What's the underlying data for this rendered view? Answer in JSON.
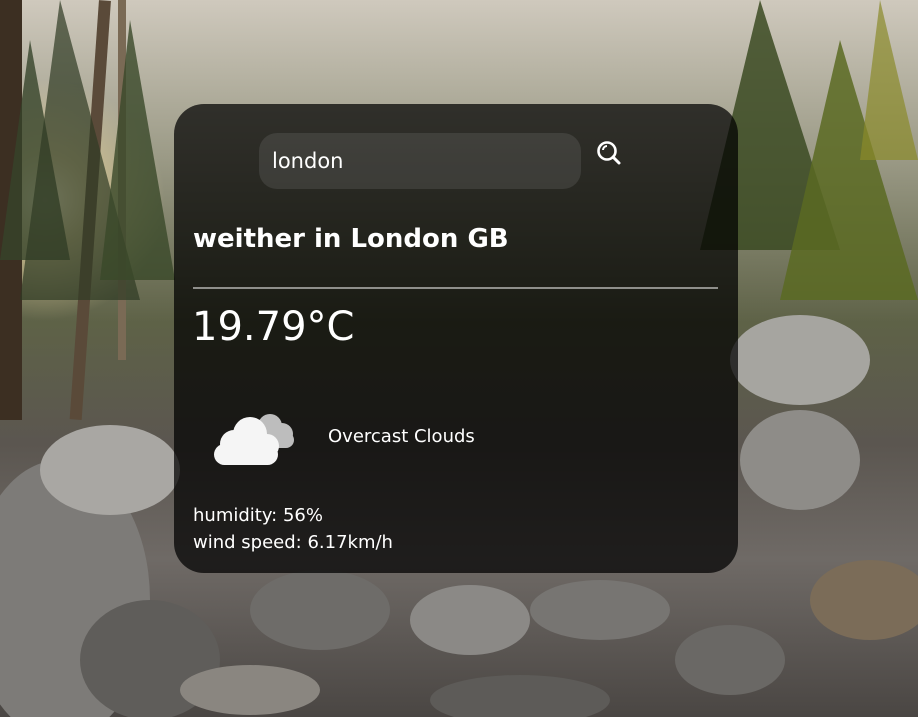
{
  "search": {
    "value": "london",
    "placeholder": ""
  },
  "weather": {
    "title": "weither in London GB",
    "temperature": "19.79°C",
    "condition": "Overcast Clouds",
    "humidity": "humidity: 56%",
    "wind": "wind speed: 6.17km/h"
  },
  "icons": {
    "search": "search-icon",
    "condition": "overcast-clouds-icon"
  },
  "colors": {
    "card_bg": "#000000b8",
    "text": "#ffffff",
    "search_bg": "#82828238"
  }
}
